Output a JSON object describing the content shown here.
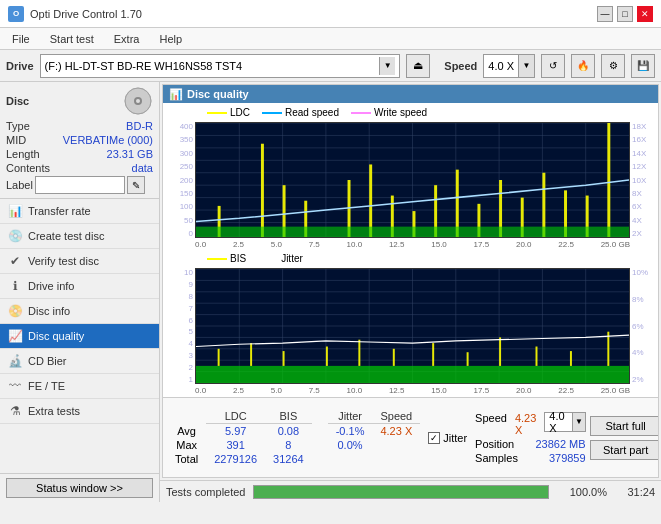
{
  "titlebar": {
    "title": "Opti Drive Control 1.70",
    "min_btn": "—",
    "max_btn": "□",
    "close_btn": "✕"
  },
  "menubar": {
    "items": [
      "File",
      "Start test",
      "Extra",
      "Help"
    ]
  },
  "toolbar": {
    "drive_label": "Drive",
    "drive_value": "(F:)  HL-DT-ST BD-RE  WH16NS58 TST4",
    "speed_label": "Speed",
    "speed_value": "4.0 X"
  },
  "sidebar": {
    "disc_section": "Disc",
    "disc_fields": [
      {
        "key": "Type",
        "value": "BD-R"
      },
      {
        "key": "MID",
        "value": "VERBATIMe (000)"
      },
      {
        "key": "Length",
        "value": "23.31 GB"
      },
      {
        "key": "Contents",
        "value": "data"
      }
    ],
    "label_placeholder": "",
    "nav_items": [
      {
        "id": "transfer-rate",
        "label": "Transfer rate",
        "active": false
      },
      {
        "id": "create-test-disc",
        "label": "Create test disc",
        "active": false
      },
      {
        "id": "verify-test-disc",
        "label": "Verify test disc",
        "active": false
      },
      {
        "id": "drive-info",
        "label": "Drive info",
        "active": false
      },
      {
        "id": "disc-info",
        "label": "Disc info",
        "active": false
      },
      {
        "id": "disc-quality",
        "label": "Disc quality",
        "active": true
      },
      {
        "id": "cd-bier",
        "label": "CD Bier",
        "active": false
      },
      {
        "id": "fe-te",
        "label": "FE / TE",
        "active": false
      },
      {
        "id": "extra-tests",
        "label": "Extra tests",
        "active": false
      }
    ],
    "status_btn": "Status window >>"
  },
  "chart": {
    "title": "Disc quality",
    "legend_top": [
      {
        "label": "LDC",
        "color": "#ffff00"
      },
      {
        "label": "Read speed",
        "color": "#00aaff"
      },
      {
        "label": "Write speed",
        "color": "#ff88ff"
      }
    ],
    "legend_bottom": [
      {
        "label": "BIS",
        "color": "#ffff00"
      },
      {
        "label": "Jitter",
        "color": "#ffffff"
      }
    ],
    "top_y_labels": [
      "400",
      "350",
      "300",
      "250",
      "200",
      "150",
      "100",
      "50",
      "0"
    ],
    "top_y_labels_right": [
      "18X",
      "16X",
      "14X",
      "12X",
      "10X",
      "8X",
      "6X",
      "4X",
      "2X"
    ],
    "bottom_y_labels": [
      "10",
      "9",
      "8",
      "7",
      "6",
      "5",
      "4",
      "3",
      "2",
      "1"
    ],
    "bottom_y_labels_right": [
      "10%",
      "8%",
      "6%",
      "4%",
      "2%"
    ],
    "x_labels": [
      "0.0",
      "2.5",
      "5.0",
      "7.5",
      "10.0",
      "12.5",
      "15.0",
      "17.5",
      "20.0",
      "22.5",
      "25.0 GB"
    ]
  },
  "stats": {
    "headers": [
      "LDC",
      "BIS",
      "",
      "Jitter",
      "Speed",
      ""
    ],
    "rows": [
      {
        "label": "Avg",
        "ldc": "5.97",
        "bis": "0.08",
        "jitter": "-0.1%",
        "speed_label": "4.23 X",
        "speed_dropdown": "4.0 X"
      },
      {
        "label": "Max",
        "ldc": "391",
        "bis": "8",
        "jitter": "0.0%",
        "pos_label": "Position",
        "pos_val": "23862 MB"
      },
      {
        "label": "Total",
        "ldc": "2279126",
        "bis": "31264",
        "jitter": "",
        "samples_label": "Samples",
        "samples_val": "379859"
      }
    ],
    "jitter_checked": true,
    "start_full_btn": "Start full",
    "start_part_btn": "Start part"
  },
  "statusbar": {
    "text": "Tests completed",
    "progress": 100,
    "progress_text": "100.0%",
    "time": "31:24"
  }
}
